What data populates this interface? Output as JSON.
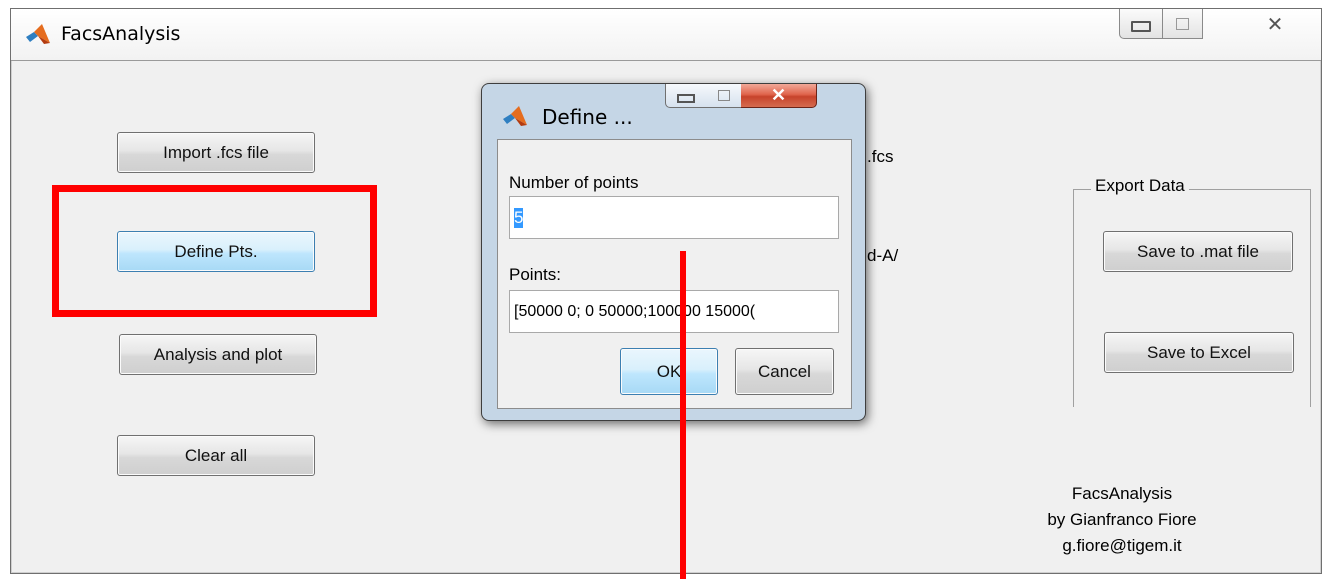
{
  "main_window": {
    "title": "FacsAnalysis",
    "controls": {
      "minimize_glyph": "▭",
      "maximize_glyph": "□",
      "close_glyph": "✕"
    }
  },
  "left_buttons": {
    "import": "Import .fcs file",
    "define": "Define Pts.",
    "analysis": "Analysis and plot",
    "clear": "Clear all"
  },
  "hidden_labels": {
    "fcs_suffix": ".fcs",
    "axis_suffix": "d-A/"
  },
  "export_panel": {
    "legend": "Export Data",
    "save_mat": "Save to .mat file",
    "save_excel": "Save to Excel"
  },
  "credits": {
    "line1": "FacsAnalysis",
    "line2": "by Gianfranco Fiore",
    "line3": "g.fiore@tigem.it"
  },
  "dialog": {
    "title": "Define ...",
    "number_label": "Number of points",
    "number_value": "5",
    "points_label": "Points:",
    "points_value": "[50000 0; 0 50000;100000 15000(",
    "ok": "OK",
    "cancel": "Cancel",
    "close_glyph": "✕"
  },
  "colors": {
    "highlight": "#ff0000",
    "window_bg": "#f0f0f0",
    "dialog_frame": "#c5d6e6",
    "active_button": "#bee6fd"
  },
  "icons": {
    "app": "matlab-icon"
  }
}
